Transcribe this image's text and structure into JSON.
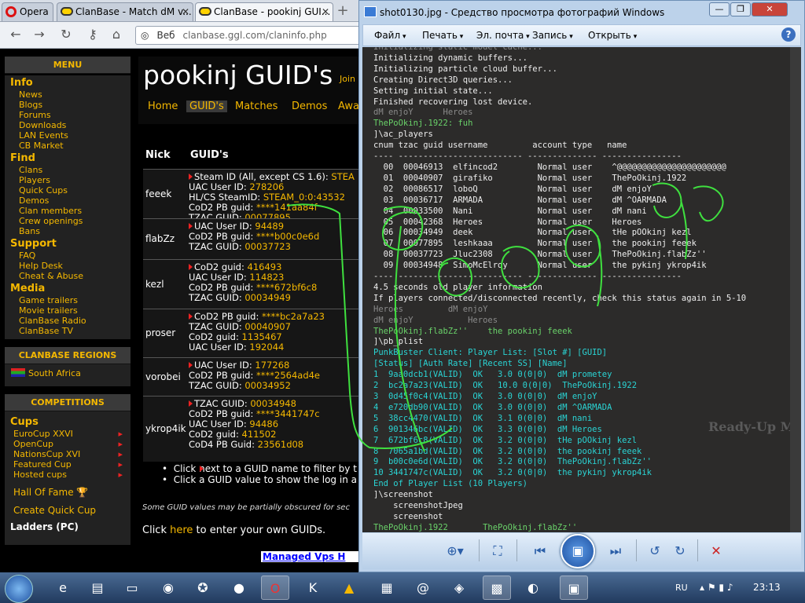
{
  "browser": {
    "tabs": [
      {
        "label": "Opera"
      },
      {
        "label": "ClanBase - Match dM v..."
      },
      {
        "label": "ClanBase - pookinj GUI..."
      }
    ],
    "address": {
      "prefix": "Веб",
      "url": "clanbase.ggl.com/claninfo.php"
    }
  },
  "sidebar": {
    "menu_header": "MENU",
    "sections": [
      {
        "title": "Info",
        "items": [
          "News",
          "Blogs",
          "Forums",
          "Downloads",
          "LAN Events",
          "CB Market"
        ]
      },
      {
        "title": "Find",
        "items": [
          "Clans",
          "Players",
          "Quick Cups",
          "Demos",
          "Clan members",
          "Crew openings",
          "Bans"
        ]
      },
      {
        "title": "Support",
        "items": [
          "FAQ",
          "Help Desk",
          "Cheat & Abuse"
        ]
      },
      {
        "title": "Media",
        "items": [
          "Game trailers",
          "Movie trailers",
          "ClanBase Radio",
          "ClanBase TV"
        ]
      }
    ],
    "regions_header": "CLANBASE REGIONS",
    "region": "South Africa",
    "competitions_header": "COMPETITIONS",
    "cups_title": "Cups",
    "cups": [
      "EuroCup XXVI",
      "OpenCup",
      "NationsCup XVI",
      "Featured Cup",
      "Hosted cups"
    ],
    "hall_of_fame": "Hall Of Fame",
    "create_quick_cup": "Create Quick Cup",
    "ladders": "Ladders (PC)"
  },
  "site": {
    "title": "pookinj GUID's",
    "join": "Join",
    "nav": [
      "Home",
      "GUID's",
      "Matches",
      "Demos",
      "Awa"
    ],
    "table_headers": {
      "nick": "Nick",
      "guid": "GUID's"
    },
    "rows": [
      {
        "nick": "feeek",
        "lines": [
          {
            "label": "Steam ID (All, except CS 1.6): ",
            "value": "STEA",
            "arrow": true
          },
          {
            "label": "UAC User ID: ",
            "value": "278206"
          },
          {
            "label": "HL/CS SteamID: ",
            "value": "STEAM_0:0:43532"
          },
          {
            "label": "CoD2 PB guid: ",
            "value": "****141aa84f"
          },
          {
            "label": "TZAC GUID: ",
            "value": "00077895"
          }
        ]
      },
      {
        "nick": "flabZz",
        "lines": [
          {
            "label": "UAC User ID: ",
            "value": "94489",
            "arrow": true
          },
          {
            "label": "CoD2 PB guid: ",
            "value": "****b00c0e6d"
          },
          {
            "label": "TZAC GUID: ",
            "value": "00037723"
          }
        ]
      },
      {
        "nick": "kezl",
        "lines": [
          {
            "label": "CoD2 guid: ",
            "value": "416493",
            "arrow": true
          },
          {
            "label": "UAC User ID: ",
            "value": "114823"
          },
          {
            "label": "CoD2 PB guid: ",
            "value": "****672bf6c8"
          },
          {
            "label": "TZAC GUID: ",
            "value": "00034949"
          }
        ]
      },
      {
        "nick": "proser",
        "lines": [
          {
            "label": "CoD2 PB guid: ",
            "value": "****bc2a7a23",
            "arrow": true
          },
          {
            "label": "TZAC GUID: ",
            "value": "00040907"
          },
          {
            "label": "CoD2 guid: ",
            "value": "1135467"
          },
          {
            "label": "UAC User ID: ",
            "value": "192044"
          }
        ]
      },
      {
        "nick": "vorobei",
        "lines": [
          {
            "label": "UAC User ID: ",
            "value": "177268",
            "arrow": true
          },
          {
            "label": "CoD2 PB guid: ",
            "value": "****2564ad4e"
          },
          {
            "label": "TZAC GUID: ",
            "value": "00034952"
          }
        ]
      },
      {
        "nick": "ykrop4ik",
        "lines": [
          {
            "label": "TZAC GUID: ",
            "value": "00034948",
            "arrow": true
          },
          {
            "label": "CoD2 PB guid: ",
            "value": "****3441747c"
          },
          {
            "label": "UAC User ID: ",
            "value": "94486"
          },
          {
            "label": "CoD2 guid: ",
            "value": "411502"
          },
          {
            "label": "CoD4 PB Guid: ",
            "value": "23561d08"
          }
        ]
      }
    ],
    "note1": "Click   next to a GUID name to filter by t",
    "note2": "Click a GUID value to show the log in a r",
    "obscured": "Some GUID values may be partially obscured for sec",
    "click_prefix": "Click ",
    "click_link": "here",
    "click_suffix": " to enter your own GUIDs.",
    "ad": "Managed Vps H"
  },
  "viewer": {
    "title": "shot0130.jpg - Средство просмотра фотографий Windows",
    "menu": [
      "Файл",
      "Печать",
      "Эл. почта",
      "Запись",
      "Открыть"
    ],
    "help": "?",
    "ready_up": "Ready-Up M",
    "console": [
      {
        "t": "Initializing static model cache...",
        "c": "gy"
      },
      {
        "t": "Initializing dynamic buffers...",
        "c": "w"
      },
      {
        "t": "Initializing particle cloud buffer...",
        "c": "w"
      },
      {
        "t": "Creating Direct3D queries...",
        "c": "w"
      },
      {
        "t": "Setting initial state...",
        "c": "w"
      },
      {
        "t": "Finished recovering lost device.",
        "c": "w"
      },
      {
        "t": "dM enjoY      Heroes",
        "c": "gy"
      },
      {
        "t": "ThePoOkinj.1922: fuh",
        "c": "g"
      },
      {
        "t": "]\\ac_players",
        "c": "w"
      },
      {
        "t": "cnum tzac guid username         account type   name",
        "c": "w"
      },
      {
        "t": "---- ------------------------- -------------- ----------------",
        "c": "w"
      },
      {
        "t": "  00  00046913  elfincod2        Normal user    ^@@@@@@@@@@@@@@@@@@@@@@",
        "c": "w"
      },
      {
        "t": "  01  00040907  girafiko         Normal user    ThePoOkinj.1922",
        "c": "w"
      },
      {
        "t": "  02  00086517  loboQ            Normal user    dM enjoY",
        "c": "w"
      },
      {
        "t": "  03  00036717  ARMADA           Normal user    dM ^OARMADA",
        "c": "w"
      },
      {
        "t": "  04  00033500  Nani             Normal user    dM nani",
        "c": "w"
      },
      {
        "t": "  05  00042368  Heroes           Normal user    Heroes",
        "c": "w"
      },
      {
        "t": "  06  00034949  deek             Normal user    tHe pOOkinj kezl",
        "c": "w"
      },
      {
        "t": "  07  00077895  leshkaaa         Normal user    the pookinj feeek",
        "c": "w"
      },
      {
        "t": "  08  00037723  Jluc2308         Normal user    ThePoOkinj.flabZz''",
        "c": "w"
      },
      {
        "t": "  09  00034948  SimoMcElroy      Normal user    the pykinj ykrop4ik",
        "c": "w"
      },
      {
        "t": "---- ------------------------- -------------- ----------------",
        "c": "w"
      },
      {
        "t": "4.5 seconds old player information",
        "c": "w"
      },
      {
        "t": "If players connected/disconnected recently, check this status again in 5-10",
        "c": "w"
      },
      {
        "t": "Heroes         dM enjoY",
        "c": "gy"
      },
      {
        "t": "dM enjoY           Heroes",
        "c": "gy"
      },
      {
        "t": "ThePoOkinj.flabZz''    the pookinj feeek",
        "c": "g"
      },
      {
        "t": "]\\pb_plist",
        "c": "w"
      },
      {
        "t": "PunkBuster Client: Player List: [Slot #] [GUID]",
        "c": "c"
      },
      {
        "t": "[Status] [Auth Rate] [Recent SS] [Name]",
        "c": "c"
      },
      {
        "t": "1  9aa0dcb1(VALID)  OK   3.0 0(0|0)  dM prometey",
        "c": "c"
      },
      {
        "t": "2  bc2a7a23(VALID)  OK   10.0 0(0|0)  ThePoOkinj.1922",
        "c": "c"
      },
      {
        "t": "3  0d45f0c4(VALID)  OK   3.0 0(0|0)  dM enjoY",
        "c": "c"
      },
      {
        "t": "4  e720db90(VALID)  OK   3.0 0(0|0)  dM ^OARMADA",
        "c": "c"
      },
      {
        "t": "5  38cc4470(VALID)  OK   3.1 0(0|0)  dM nani",
        "c": "c"
      },
      {
        "t": "6  901346bc(VALID)  OK   3.3 0(0|0)  dM Heroes",
        "c": "c"
      },
      {
        "t": "7  672bf6c8(VALID)  OK   3.2 0(0|0)  tHe pOOkinj kezl",
        "c": "c"
      },
      {
        "t": "8  7065a1bd(VALID)  OK   3.2 0(0|0)  the pookinj feeek",
        "c": "c"
      },
      {
        "t": "9  b00c0e6d(VALID)  OK   3.2 0(0|0)  ThePoOkinj.flabZz''",
        "c": "c"
      },
      {
        "t": "10 3441747c(VALID)  OK   3.2 0(0|0)  the pykinj ykrop4ik",
        "c": "c"
      },
      {
        "t": "End of Player List (10 Players)",
        "c": "c"
      },
      {
        "t": "]\\screenshot",
        "c": "w"
      },
      {
        "t": "    screenshotJpeg",
        "c": "w"
      },
      {
        "t": "    screenshot",
        "c": "w"
      },
      {
        "t": "ThePoOkinj.1922       ThePoOkinj.flabZz''",
        "c": "g"
      }
    ]
  },
  "taskbar": {
    "lang": "RU",
    "clock": "23:13"
  },
  "colors": {
    "accent": "#f5b800",
    "console_bg": "#2c2b2a",
    "scribble": "#3fe03f"
  }
}
